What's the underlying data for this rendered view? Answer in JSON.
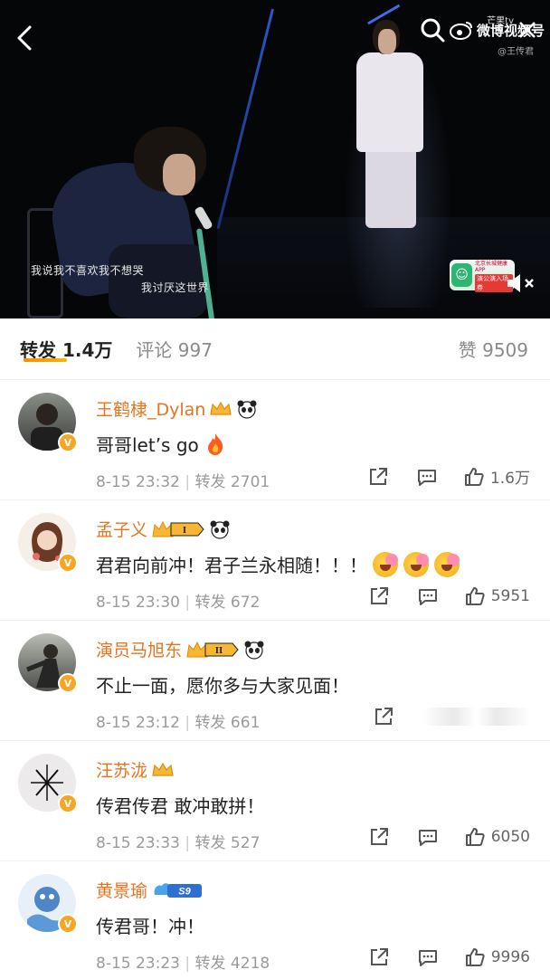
{
  "video": {
    "subtitle_line1": "我说我不喜欢我不想哭",
    "subtitle_line2": "我讨厌这世界",
    "top_right_label": "微博视频号",
    "mango_tag": "芒果tv",
    "handle": "@王传君",
    "ad_line1": "北京长城健康APP",
    "ad_line2": "演公演入场券"
  },
  "tabs": {
    "repost": "转发 1.4万",
    "comments": "评论 997",
    "likes": "赞 9509"
  },
  "comments": [
    {
      "user": "王鹤棣_Dylan",
      "text": "哥哥let’s go",
      "time": "8-15 23:32",
      "reposts": "转发 2701",
      "likes": "1.6万",
      "badge": "crown"
    },
    {
      "user": "孟子义",
      "text": "君君向前冲！君子兰永相随！！！",
      "time": "8-15 23:30",
      "reposts": "转发 672",
      "likes": "5951",
      "badge": "vip-1"
    },
    {
      "user": "演员马旭东",
      "text": "不止一面，愿你多与大家见面！",
      "time": "8-15 23:12",
      "reposts": "转发 661",
      "likes": "",
      "badge": "vip-2"
    },
    {
      "user": "汪苏泷",
      "text": "传君传君 敢冲敢拼！",
      "time": "8-15 23:33",
      "reposts": "转发 527",
      "likes": "6050",
      "badge": "crown"
    },
    {
      "user": "黄景瑜",
      "text": "传君哥！冲！",
      "time": "8-15 23:23",
      "reposts": "转发 4218",
      "likes": "9996",
      "badge": "s9"
    }
  ],
  "vip_labels": {
    "one": "I",
    "two": "II",
    "s9": "S9"
  },
  "colors": {
    "accent": "#ff8a00",
    "username": "#e8731e",
    "meta": "#9a9a9a"
  },
  "icons": [
    "back-arrow-icon",
    "search-icon",
    "weibo-logo-icon",
    "close-icon",
    "mute-icon",
    "share-icon",
    "reply-icon",
    "like-icon",
    "fire-icon",
    "crown-icon",
    "panda-icon"
  ]
}
